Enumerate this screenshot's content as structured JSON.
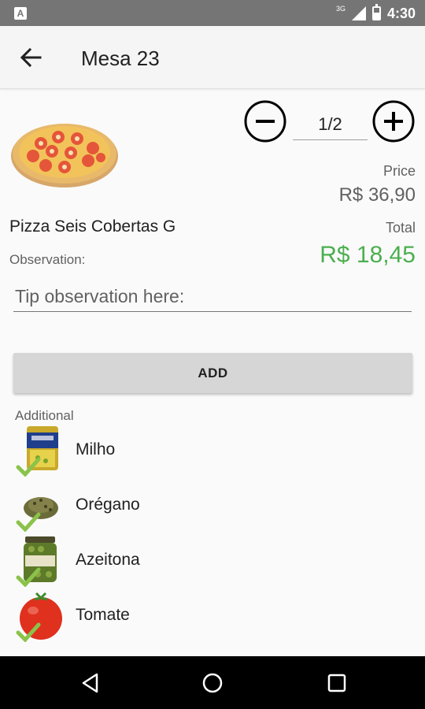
{
  "status_bar": {
    "app_badge": "A",
    "network": "3G",
    "time": "4:30"
  },
  "app_bar": {
    "title": "Mesa 23",
    "back_icon": "arrow-back-icon"
  },
  "product": {
    "name": "Pizza Seis Cobertas G",
    "image_icon": "pizza-image",
    "observation_label": "Observation:",
    "observation_placeholder": "Tip observation here:",
    "observation_value": ""
  },
  "quantity": {
    "value": "1/2",
    "minus_icon": "minus-circle-icon",
    "plus_icon": "plus-circle-icon"
  },
  "pricing": {
    "price_label": "Price",
    "price_value": "R$ 36,90",
    "total_label": "Total",
    "total_value": "R$ 18,45",
    "total_color": "#4caf50"
  },
  "add_button": {
    "label": "ADD"
  },
  "additional": {
    "label": "Additional",
    "items": [
      {
        "name": "Milho",
        "icon": "corn-can-image",
        "checked": true
      },
      {
        "name": "Orégano",
        "icon": "oregano-image",
        "checked": true
      },
      {
        "name": "Azeitona",
        "icon": "olive-jar-image",
        "checked": true
      },
      {
        "name": "Tomate",
        "icon": "tomato-image",
        "checked": true
      }
    ]
  },
  "nav_bar": {
    "back_icon": "nav-back-icon",
    "home_icon": "nav-home-icon",
    "recents_icon": "nav-recents-icon"
  },
  "colors": {
    "status_bar": "#757575",
    "app_bar": "#f5f5f5",
    "check": "#8bc34a",
    "add_button": "#d6d6d6"
  }
}
